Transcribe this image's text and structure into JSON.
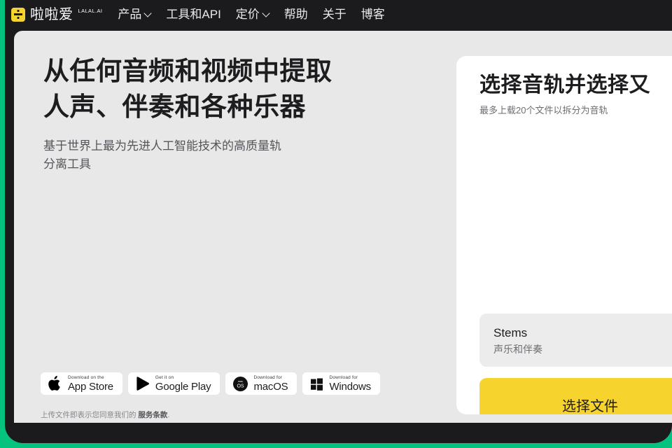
{
  "navbar": {
    "brand": {
      "name": "啦啦爱",
      "sup": "LALAL.AI",
      "logo_icon": "divide-square-icon"
    },
    "items": [
      {
        "label": "产品",
        "has_chevron": true
      },
      {
        "label": "工具和API",
        "has_chevron": false
      },
      {
        "label": "定价",
        "has_chevron": true
      },
      {
        "label": "帮助",
        "has_chevron": false
      },
      {
        "label": "关于",
        "has_chevron": false
      },
      {
        "label": "博客",
        "has_chevron": false
      }
    ]
  },
  "hero": {
    "headline": "从任何音频和视频中提取\n人声、伴奏和各种乐器",
    "subhead": "基于世界上最为先进人工智能技术的高质量轨\n分离工具"
  },
  "badges": [
    {
      "icon": "apple-icon",
      "top": "Download on the",
      "main": "App Store"
    },
    {
      "icon": "google-play-icon",
      "top": "Get it on",
      "main": "Google Play"
    },
    {
      "icon": "macos-icon",
      "top": "Download for",
      "main": "macOS"
    },
    {
      "icon": "windows-icon",
      "top": "Download for",
      "main": "Windows"
    }
  ],
  "terms": {
    "text": "上传文件即表示您同意我们的 ",
    "link": "服务条款",
    "suffix": "."
  },
  "card": {
    "title": "选择音轨并选择又",
    "subtitle": "最多上载20个文件以拆分为音轨",
    "stems": {
      "title": "Stems",
      "subtitle": "声乐和伴奏"
    },
    "choose_button": "选择文件"
  },
  "colors": {
    "green_bg": "#05c27e",
    "frame_dark": "#1b1b1e",
    "page_gray": "#e8e8e8",
    "accent_yellow": "#f6d32d",
    "card_white": "#ffffff",
    "stems_gray": "#ececec"
  }
}
